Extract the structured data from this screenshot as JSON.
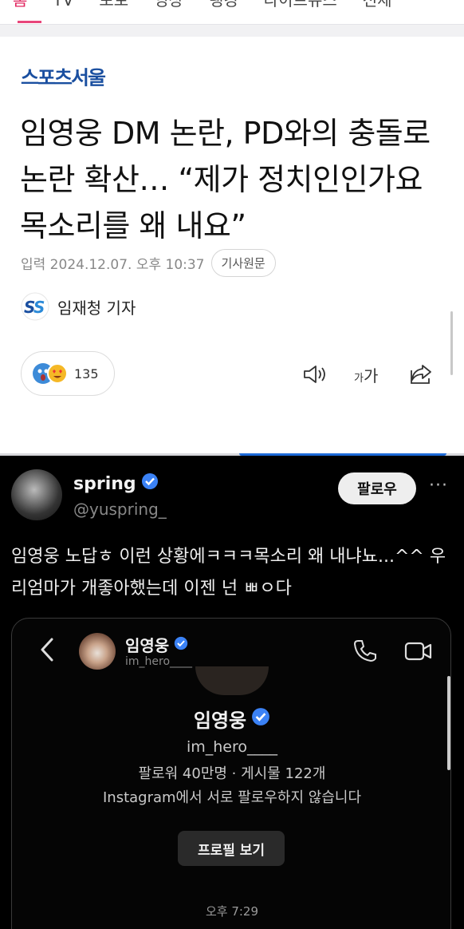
{
  "nav": {
    "tabs": [
      "홈",
      "TV",
      "포토",
      "영상",
      "랭킹",
      "라이브뉴스",
      "전체"
    ]
  },
  "brand": {
    "name": "스포츠서울"
  },
  "article": {
    "headline": "임영웅 DM 논란, PD와의 충돌로 논란 확산… “제가 정치인인가요 목소리를 왜 내요”",
    "date": "입력 2024.12.07. 오후 10:37",
    "original_label": "기사원문",
    "reporter": "임재청 기자",
    "reaction_count": "135",
    "font_size_label": "가가"
  },
  "tweet": {
    "display_name": "spring",
    "handle": "@yuspring_",
    "follow_label": "팔로우",
    "more": "···",
    "text": "임영웅 노답ㅎ 이런 상황에ㅋㅋㅋ목소리 왜 내냐뇨...^^ 우리엄마가 개좋아했는데 이젠 넌 ㅃㅇ다"
  },
  "dm": {
    "name": "임영웅",
    "handle": "im_hero____",
    "profile_name": "임영웅",
    "profile_handle": "im_hero____",
    "stats": "팔로워 40만명 · 게시물 122개",
    "mutual": "Instagram에서 서로 팔로우하지 않습니다",
    "profile_button": "프로필 보기",
    "time": "오후 7:29"
  },
  "colors": {
    "accent": "#e8457a",
    "brand": "#1a4fa0",
    "verified": "#3b82f6"
  }
}
